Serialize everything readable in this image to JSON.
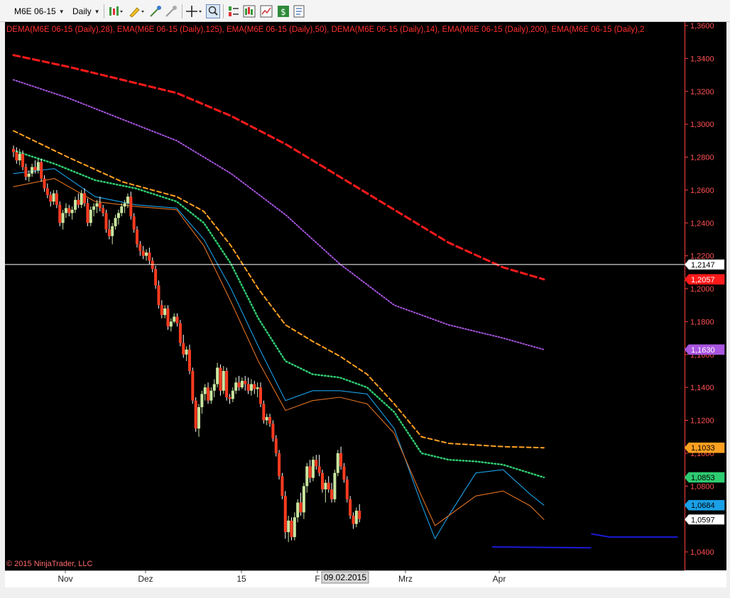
{
  "toolbar": {
    "instrument": "M6E 06-15",
    "timeframe": "Daily",
    "icons": [
      "bar-style-icon",
      "drawing-pencil-icon",
      "draw-tool-icon",
      "remove-draw-icon",
      "crosshair-icon",
      "zoom-icon",
      "chart-trader-icon",
      "strategies-icon",
      "indicators-icon",
      "money-icon",
      "properties-icon"
    ]
  },
  "chart": {
    "indicator_label": "DEMA(M6E 06-15 (Daily),28), EMA(M6E 06-15 (Daily),125), EMA(M6E 06-15 (Daily),50), DEMA(M6E 06-15 (Daily),14), EMA(M6E 06-15 (Daily),200), EMA(M6E 06-15 (Daily),2",
    "copyright": "© 2015 NinjaTrader, LLC",
    "crosshair_date": "09.02.2015",
    "colors": {
      "background": "#000000",
      "up": "#c8e6a0",
      "down": "#ff3b1f",
      "ema200": "#ff1a1a",
      "ema125": "#a855e0",
      "ema50": "#ffa020",
      "ema28": "#2ecc71",
      "dema14": "#1aa0e6",
      "dema_short": "#e07020",
      "support": "#1a1ad6"
    }
  },
  "chart_data": {
    "type": "candlestick",
    "y_ticks": [
      "1,3600",
      "1,3400",
      "1,3200",
      "1,3000",
      "1,2800",
      "1,2600",
      "1,2400",
      "1,2200",
      "1,2000",
      "1,1800",
      "1,1600",
      "1,1400",
      "1,1200",
      "1,1000",
      "1,0800",
      "1,0600",
      "1,0400"
    ],
    "x_ticks": [
      "Nov",
      "Dez",
      "15",
      "F",
      "Mrz",
      "Apr"
    ],
    "ylim": [
      1.04,
      1.36
    ],
    "price_markers": [
      {
        "value": "1,2147",
        "bg": "#ffffff",
        "fg": "#000000"
      },
      {
        "value": "1,2057",
        "bg": "#ff1a1a",
        "fg": "#ffffff"
      },
      {
        "value": "1,1630",
        "bg": "#a855e0",
        "fg": "#ffffff"
      },
      {
        "value": "1,1033",
        "bg": "#ffa020",
        "fg": "#000000"
      },
      {
        "value": "1,0853",
        "bg": "#2ecc71",
        "fg": "#000000"
      },
      {
        "value": "1,0684",
        "bg": "#1aa0e6",
        "fg": "#000000"
      },
      {
        "value": "1,0597",
        "bg": "#ffffff",
        "fg": "#000000"
      }
    ],
    "candles": [
      [
        1.285,
        1.287,
        1.28,
        1.283
      ],
      [
        1.283,
        1.286,
        1.276,
        1.278
      ],
      [
        1.278,
        1.285,
        1.275,
        1.282
      ],
      [
        1.282,
        1.284,
        1.272,
        1.274
      ],
      [
        1.274,
        1.276,
        1.266,
        1.268
      ],
      [
        1.268,
        1.272,
        1.265,
        1.27
      ],
      [
        1.27,
        1.276,
        1.268,
        1.274
      ],
      [
        1.274,
        1.278,
        1.27,
        1.272
      ],
      [
        1.272,
        1.279,
        1.27,
        1.277
      ],
      [
        1.277,
        1.279,
        1.265,
        1.267
      ],
      [
        1.267,
        1.269,
        1.259,
        1.261
      ],
      [
        1.261,
        1.264,
        1.255,
        1.257
      ],
      [
        1.257,
        1.259,
        1.25,
        1.253
      ],
      [
        1.253,
        1.26,
        1.251,
        1.258
      ],
      [
        1.258,
        1.26,
        1.249,
        1.251
      ],
      [
        1.251,
        1.253,
        1.238,
        1.24
      ],
      [
        1.24,
        1.248,
        1.236,
        1.246
      ],
      [
        1.246,
        1.252,
        1.243,
        1.249
      ],
      [
        1.249,
        1.251,
        1.244,
        1.246
      ],
      [
        1.246,
        1.25,
        1.242,
        1.248
      ],
      [
        1.248,
        1.256,
        1.246,
        1.254
      ],
      [
        1.254,
        1.258,
        1.249,
        1.251
      ],
      [
        1.251,
        1.26,
        1.249,
        1.258
      ],
      [
        1.258,
        1.261,
        1.25,
        1.252
      ],
      [
        1.252,
        1.255,
        1.238,
        1.24
      ],
      [
        1.24,
        1.25,
        1.238,
        1.248
      ],
      [
        1.248,
        1.252,
        1.244,
        1.25
      ],
      [
        1.25,
        1.254,
        1.246,
        1.252
      ],
      [
        1.252,
        1.256,
        1.247,
        1.249
      ],
      [
        1.249,
        1.251,
        1.244,
        1.246
      ],
      [
        1.246,
        1.248,
        1.234,
        1.236
      ],
      [
        1.236,
        1.242,
        1.23,
        1.232
      ],
      [
        1.232,
        1.24,
        1.227,
        1.238
      ],
      [
        1.238,
        1.245,
        1.236,
        1.243
      ],
      [
        1.243,
        1.248,
        1.239,
        1.246
      ],
      [
        1.246,
        1.252,
        1.244,
        1.25
      ],
      [
        1.25,
        1.254,
        1.246,
        1.252
      ],
      [
        1.252,
        1.258,
        1.249,
        1.256
      ],
      [
        1.256,
        1.259,
        1.242,
        1.244
      ],
      [
        1.244,
        1.246,
        1.234,
        1.236
      ],
      [
        1.236,
        1.238,
        1.225,
        1.227
      ],
      [
        1.227,
        1.229,
        1.22,
        1.223
      ],
      [
        1.223,
        1.226,
        1.218,
        1.22
      ],
      [
        1.22,
        1.224,
        1.217,
        1.222
      ],
      [
        1.222,
        1.225,
        1.215,
        1.217
      ],
      [
        1.217,
        1.219,
        1.21,
        1.212
      ],
      [
        1.212,
        1.214,
        1.2,
        1.202
      ],
      [
        1.202,
        1.205,
        1.188,
        1.19
      ],
      [
        1.19,
        1.193,
        1.182,
        1.184
      ],
      [
        1.184,
        1.19,
        1.182,
        1.188
      ],
      [
        1.188,
        1.19,
        1.175,
        1.177
      ],
      [
        1.177,
        1.182,
        1.174,
        1.18
      ],
      [
        1.18,
        1.185,
        1.179,
        1.183
      ],
      [
        1.183,
        1.185,
        1.177,
        1.179
      ],
      [
        1.179,
        1.181,
        1.165,
        1.167
      ],
      [
        1.167,
        1.172,
        1.158,
        1.16
      ],
      [
        1.16,
        1.165,
        1.156,
        1.163
      ],
      [
        1.163,
        1.166,
        1.148,
        1.15
      ],
      [
        1.15,
        1.152,
        1.13,
        1.132
      ],
      [
        1.132,
        1.134,
        1.113,
        1.115
      ],
      [
        1.115,
        1.13,
        1.11,
        1.128
      ],
      [
        1.128,
        1.138,
        1.124,
        1.136
      ],
      [
        1.136,
        1.142,
        1.132,
        1.14
      ],
      [
        1.14,
        1.143,
        1.13,
        1.132
      ],
      [
        1.132,
        1.14,
        1.13,
        1.138
      ],
      [
        1.138,
        1.145,
        1.134,
        1.142
      ],
      [
        1.142,
        1.155,
        1.14,
        1.152
      ],
      [
        1.152,
        1.154,
        1.135,
        1.138
      ],
      [
        1.138,
        1.153,
        1.136,
        1.15
      ],
      [
        1.15,
        1.152,
        1.132,
        1.134
      ],
      [
        1.134,
        1.136,
        1.13,
        1.133
      ],
      [
        1.133,
        1.14,
        1.131,
        1.138
      ],
      [
        1.138,
        1.146,
        1.136,
        1.143
      ],
      [
        1.143,
        1.147,
        1.138,
        1.14
      ],
      [
        1.14,
        1.146,
        1.139,
        1.144
      ],
      [
        1.144,
        1.147,
        1.138,
        1.142
      ],
      [
        1.142,
        1.146,
        1.136,
        1.138
      ],
      [
        1.138,
        1.145,
        1.135,
        1.142
      ],
      [
        1.142,
        1.144,
        1.136,
        1.139
      ],
      [
        1.139,
        1.143,
        1.134,
        1.14
      ],
      [
        1.14,
        1.143,
        1.128,
        1.13
      ],
      [
        1.13,
        1.132,
        1.118,
        1.12
      ],
      [
        1.12,
        1.124,
        1.117,
        1.122
      ],
      [
        1.122,
        1.124,
        1.116,
        1.118
      ],
      [
        1.118,
        1.12,
        1.107,
        1.109
      ],
      [
        1.109,
        1.111,
        1.098,
        1.1
      ],
      [
        1.1,
        1.102,
        1.084,
        1.086
      ],
      [
        1.086,
        1.088,
        1.072,
        1.074
      ],
      [
        1.074,
        1.077,
        1.048,
        1.052
      ],
      [
        1.052,
        1.062,
        1.046,
        1.059
      ],
      [
        1.059,
        1.061,
        1.047,
        1.049
      ],
      [
        1.049,
        1.064,
        1.047,
        1.061
      ],
      [
        1.061,
        1.072,
        1.058,
        1.07
      ],
      [
        1.07,
        1.076,
        1.062,
        1.064
      ],
      [
        1.064,
        1.082,
        1.06,
        1.08
      ],
      [
        1.08,
        1.094,
        1.076,
        1.092
      ],
      [
        1.092,
        1.096,
        1.082,
        1.085
      ],
      [
        1.085,
        1.098,
        1.083,
        1.096
      ],
      [
        1.096,
        1.099,
        1.09,
        1.092
      ],
      [
        1.092,
        1.099,
        1.086,
        1.088
      ],
      [
        1.088,
        1.09,
        1.076,
        1.078
      ],
      [
        1.078,
        1.084,
        1.07,
        1.082
      ],
      [
        1.082,
        1.086,
        1.076,
        1.078
      ],
      [
        1.078,
        1.082,
        1.07,
        1.072
      ],
      [
        1.072,
        1.09,
        1.07,
        1.088
      ],
      [
        1.088,
        1.102,
        1.086,
        1.1
      ],
      [
        1.1,
        1.104,
        1.09,
        1.092
      ],
      [
        1.092,
        1.094,
        1.082,
        1.084
      ],
      [
        1.084,
        1.086,
        1.07,
        1.072
      ],
      [
        1.072,
        1.074,
        1.06,
        1.062
      ],
      [
        1.062,
        1.064,
        1.054,
        1.057
      ],
      [
        1.057,
        1.067,
        1.055,
        1.065
      ],
      [
        1.065,
        1.069,
        1.058,
        1.06
      ]
    ],
    "series": [
      {
        "key": "ema200",
        "style": "dashed-thick",
        "points": [
          [
            0,
            1.342
          ],
          [
            20,
            1.335
          ],
          [
            40,
            1.327
          ],
          [
            60,
            1.319
          ],
          [
            80,
            1.305
          ],
          [
            100,
            1.288
          ],
          [
            120,
            1.268
          ],
          [
            140,
            1.248
          ],
          [
            160,
            1.228
          ],
          [
            180,
            1.213
          ],
          [
            195,
            1.2057
          ]
        ]
      },
      {
        "key": "ema125",
        "style": "dotted",
        "points": [
          [
            0,
            1.327
          ],
          [
            20,
            1.316
          ],
          [
            40,
            1.303
          ],
          [
            60,
            1.29
          ],
          [
            80,
            1.27
          ],
          [
            100,
            1.245
          ],
          [
            120,
            1.215
          ],
          [
            140,
            1.19
          ],
          [
            160,
            1.178
          ],
          [
            180,
            1.17
          ],
          [
            195,
            1.163
          ]
        ]
      },
      {
        "key": "ema50",
        "style": "dashed",
        "points": [
          [
            0,
            1.296
          ],
          [
            20,
            1.28
          ],
          [
            40,
            1.265
          ],
          [
            60,
            1.256
          ],
          [
            70,
            1.247
          ],
          [
            80,
            1.226
          ],
          [
            90,
            1.2
          ],
          [
            100,
            1.178
          ],
          [
            110,
            1.168
          ],
          [
            120,
            1.159
          ],
          [
            130,
            1.148
          ],
          [
            140,
            1.13
          ],
          [
            150,
            1.11
          ],
          [
            160,
            1.106
          ],
          [
            170,
            1.105
          ],
          [
            180,
            1.104
          ],
          [
            195,
            1.1033
          ]
        ]
      },
      {
        "key": "ema28",
        "style": "dotted-thick",
        "points": [
          [
            0,
            1.284
          ],
          [
            15,
            1.276
          ],
          [
            30,
            1.266
          ],
          [
            45,
            1.261
          ],
          [
            60,
            1.253
          ],
          [
            70,
            1.24
          ],
          [
            80,
            1.215
          ],
          [
            90,
            1.182
          ],
          [
            100,
            1.156
          ],
          [
            110,
            1.148
          ],
          [
            120,
            1.146
          ],
          [
            130,
            1.14
          ],
          [
            140,
            1.125
          ],
          [
            150,
            1.1
          ],
          [
            160,
            1.096
          ],
          [
            170,
            1.095
          ],
          [
            180,
            1.093
          ],
          [
            195,
            1.0853
          ]
        ]
      },
      {
        "key": "dema14",
        "style": "solid",
        "points": [
          [
            0,
            1.27
          ],
          [
            15,
            1.273
          ],
          [
            30,
            1.256
          ],
          [
            45,
            1.251
          ],
          [
            60,
            1.249
          ],
          [
            70,
            1.23
          ],
          [
            80,
            1.2
          ],
          [
            90,
            1.165
          ],
          [
            100,
            1.132
          ],
          [
            110,
            1.138
          ],
          [
            120,
            1.138
          ],
          [
            130,
            1.136
          ],
          [
            140,
            1.115
          ],
          [
            150,
            1.069
          ],
          [
            155,
            1.048
          ],
          [
            160,
            1.062
          ],
          [
            170,
            1.088
          ],
          [
            180,
            1.09
          ],
          [
            190,
            1.075
          ],
          [
            195,
            1.0684
          ]
        ]
      },
      {
        "key": "dema_short",
        "style": "solid",
        "points": [
          [
            0,
            1.262
          ],
          [
            15,
            1.267
          ],
          [
            30,
            1.253
          ],
          [
            45,
            1.25
          ],
          [
            60,
            1.248
          ],
          [
            70,
            1.226
          ],
          [
            80,
            1.192
          ],
          [
            90,
            1.156
          ],
          [
            100,
            1.126
          ],
          [
            110,
            1.132
          ],
          [
            120,
            1.134
          ],
          [
            130,
            1.13
          ],
          [
            140,
            1.112
          ],
          [
            150,
            1.074
          ],
          [
            155,
            1.056
          ],
          [
            160,
            1.062
          ],
          [
            170,
            1.074
          ],
          [
            180,
            1.077
          ],
          [
            190,
            1.068
          ],
          [
            195,
            1.0597
          ]
        ]
      }
    ],
    "support_lines": [
      {
        "points": [
          [
            155,
            1.043
          ],
          [
            187,
            1.0425
          ]
        ]
      },
      {
        "points": [
          [
            187,
            1.051
          ],
          [
            193,
            1.049
          ],
          [
            215,
            1.049
          ]
        ]
      }
    ],
    "crosshair_price": 1.2147
  }
}
